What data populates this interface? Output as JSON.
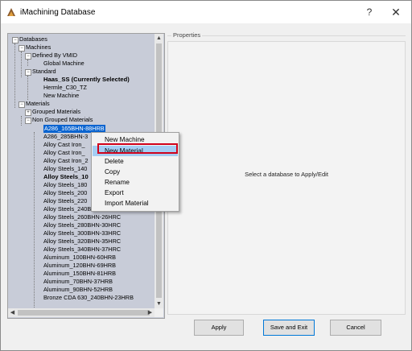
{
  "window": {
    "title": "iMachining Database",
    "help_glyph": "?",
    "close_glyph": "✕"
  },
  "tree": {
    "nodes": [
      {
        "label": "Databases",
        "bold": false,
        "selected": false
      },
      {
        "label": "Machines",
        "bold": false,
        "selected": false
      },
      {
        "label": "Defined By VMID",
        "bold": false,
        "selected": false
      },
      {
        "label": "Global Machine",
        "bold": false,
        "selected": false
      },
      {
        "label": "Standard",
        "bold": false,
        "selected": false
      },
      {
        "label": "Haas_SS (Currently Selected)",
        "bold": true,
        "selected": false
      },
      {
        "label": "Hermle_C30_TZ",
        "bold": false,
        "selected": false
      },
      {
        "label": "New Machine",
        "bold": false,
        "selected": false
      },
      {
        "label": "Materials",
        "bold": false,
        "selected": false
      },
      {
        "label": "Grouped Materials",
        "bold": false,
        "selected": false
      },
      {
        "label": "Non Grouped Materials",
        "bold": false,
        "selected": false
      },
      {
        "label": "A286_165BHN-88HRB",
        "bold": false,
        "selected": true
      },
      {
        "label": "A286_285BHN-3",
        "bold": false,
        "selected": false
      },
      {
        "label": "Alloy Cast Iron_",
        "bold": false,
        "selected": false
      },
      {
        "label": "Alloy Cast Iron_",
        "bold": false,
        "selected": false
      },
      {
        "label": "Alloy Cast Iron_2",
        "bold": false,
        "selected": false
      },
      {
        "label": "Alloy Steels_140",
        "bold": false,
        "selected": false
      },
      {
        "label": "Alloy Steels_10",
        "bold": true,
        "selected": false
      },
      {
        "label": "Alloy Steels_180",
        "bold": false,
        "selected": false
      },
      {
        "label": "Alloy Steels_200",
        "bold": false,
        "selected": false
      },
      {
        "label": "Alloy Steels_220",
        "bold": false,
        "selected": false
      },
      {
        "label": "Alloy Steels_240BHN-23HRC",
        "bold": false,
        "selected": false
      },
      {
        "label": "Alloy Steels_260BHN-26HRC",
        "bold": false,
        "selected": false
      },
      {
        "label": "Alloy Steels_280BHN-30HRC",
        "bold": false,
        "selected": false
      },
      {
        "label": "Alloy Steels_300BHN-33HRC",
        "bold": false,
        "selected": false
      },
      {
        "label": "Alloy Steels_320BHN-35HRC",
        "bold": false,
        "selected": false
      },
      {
        "label": "Alloy Steels_340BHN-37HRC",
        "bold": false,
        "selected": false
      },
      {
        "label": "Aluminum_100BHN-60HRB",
        "bold": false,
        "selected": false
      },
      {
        "label": "Aluminum_120BHN-69HRB",
        "bold": false,
        "selected": false
      },
      {
        "label": "Aluminum_150BHN-81HRB",
        "bold": false,
        "selected": false
      },
      {
        "label": "Aluminum_70BHN-37HRB",
        "bold": false,
        "selected": false
      },
      {
        "label": "Aluminum_90BHN-52HRB",
        "bold": false,
        "selected": false
      },
      {
        "label": "Bronze CDA 630_240BHN-23HRB",
        "bold": false,
        "selected": false
      }
    ]
  },
  "properties": {
    "title": "Properties",
    "message": "Select a database to Apply/Edit"
  },
  "buttons": {
    "apply": "Apply",
    "save_exit": "Save and Exit",
    "cancel": "Cancel"
  },
  "context_menu": {
    "items": [
      "New Machine",
      "New Material",
      "Delete",
      "Copy",
      "Rename",
      "Export",
      "Import Material"
    ],
    "highlighted": "New Material"
  },
  "colors": {
    "selection": "#0a64d0",
    "highlight_outline": "#d0021b",
    "tree_background": "#c8ccd8"
  },
  "icons": {
    "collapse": "minus-box",
    "expand": "plus-box"
  }
}
